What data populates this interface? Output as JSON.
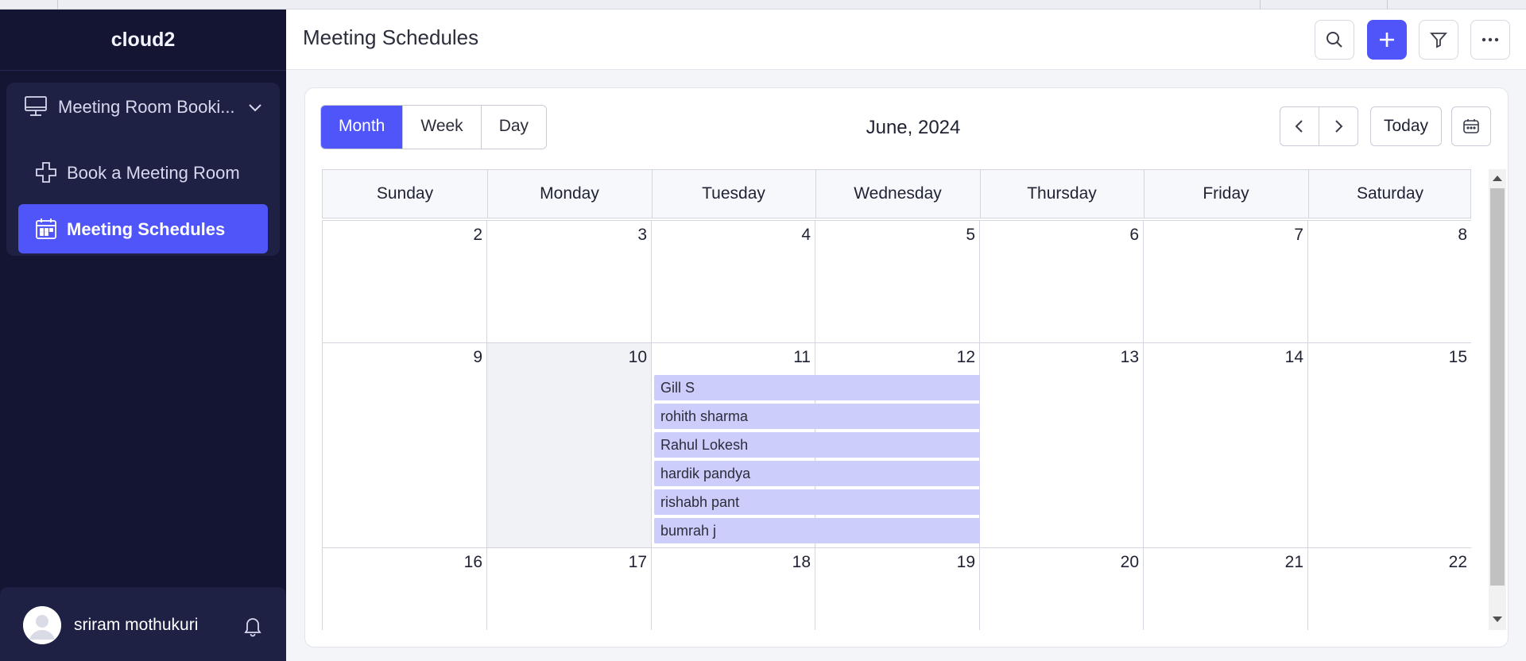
{
  "app": {
    "name": "cloud2"
  },
  "sidebar": {
    "group_label": "Meeting Room Booki...",
    "items": [
      {
        "label": "Book a Meeting Room"
      },
      {
        "label": "Meeting Schedules"
      }
    ],
    "user_name": "sriram mothukuri"
  },
  "header": {
    "title": "Meeting Schedules"
  },
  "calendar": {
    "views": [
      "Month",
      "Week",
      "Day"
    ],
    "active_view": "Month",
    "month_label": "June, 2024",
    "today_label": "Today",
    "weekdays": [
      "Sunday",
      "Monday",
      "Tuesday",
      "Wednesday",
      "Thursday",
      "Friday",
      "Saturday"
    ],
    "weeks": [
      [
        "2",
        "3",
        "4",
        "5",
        "6",
        "7",
        "8"
      ],
      [
        "9",
        "10",
        "11",
        "12",
        "13",
        "14",
        "15"
      ],
      [
        "16",
        "17",
        "18",
        "19",
        "20",
        "21",
        "22"
      ]
    ],
    "events": [
      "Gill S",
      "rohith sharma",
      "Rahul Lokesh",
      "hardik pandya",
      "rishabh pant",
      "bumrah j"
    ]
  },
  "colors": {
    "sidebar_bg": "#141532",
    "accent": "#4f55f8",
    "event_bg": "#cdcdfb"
  }
}
